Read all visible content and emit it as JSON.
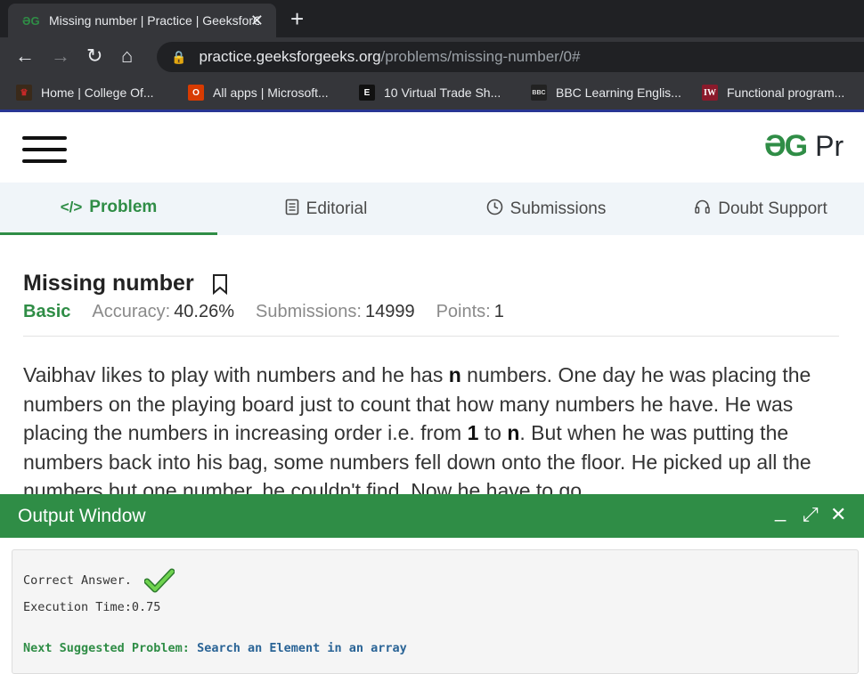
{
  "browser": {
    "tab_title": "Missing number | Practice | GeeksforGeeks",
    "tab_favicon": "gfg-icon",
    "new_tab": "+",
    "url_host": "practice.geeksforgeeks.org",
    "url_path": "/problems/missing-number/0#",
    "bookmarks": [
      {
        "label": "Home | College Of...",
        "icon": "college-crest-icon"
      },
      {
        "label": "All apps | Microsoft...",
        "icon": "office-icon"
      },
      {
        "label": "10 Virtual Trade Sh...",
        "icon": "trade-show-icon"
      },
      {
        "label": "BBC Learning Englis...",
        "icon": "bbc-icon"
      },
      {
        "label": "Functional program...",
        "icon": "iw-icon"
      }
    ]
  },
  "header": {
    "logo_mark": "ƏG",
    "logo_text": "Pr"
  },
  "tabs": [
    {
      "label": "Problem",
      "icon": "code-icon",
      "active": true
    },
    {
      "label": "Editorial",
      "icon": "document-icon",
      "active": false
    },
    {
      "label": "Submissions",
      "icon": "clock-icon",
      "active": false
    },
    {
      "label": "Doubt Support",
      "icon": "headset-icon",
      "active": false
    }
  ],
  "problem": {
    "title": "Missing number",
    "difficulty": "Basic",
    "accuracy_label": "Accuracy:",
    "accuracy": "40.26%",
    "submissions_label": "Submissions:",
    "submissions": "14999",
    "points_label": "Points:",
    "points": "1",
    "statement": [
      "Vaibhav likes to play with numbers and he has ",
      "n",
      " numbers. One day he was placing the numbers on the playing board just to count that how many numbers he have. He was placing the numbers in increasing order i.e. from ",
      "1",
      " to ",
      "n",
      ". But when he was putting the numbers back into his bag, some numbers fell down onto the floor. He picked up all the numbers but one number, he couldn't find. Now he have to go"
    ]
  },
  "output_window": {
    "title": "Output Window",
    "minimize": "_",
    "maximize": "⤢",
    "close": "✕",
    "result": "Correct Answer.",
    "execution_time": "Execution Time:0.75",
    "next_label": "Next Suggested Problem:",
    "next_problem": "Search an Element in an array"
  },
  "colors": {
    "accent": "#2f8d46",
    "link": "#2a6496"
  }
}
